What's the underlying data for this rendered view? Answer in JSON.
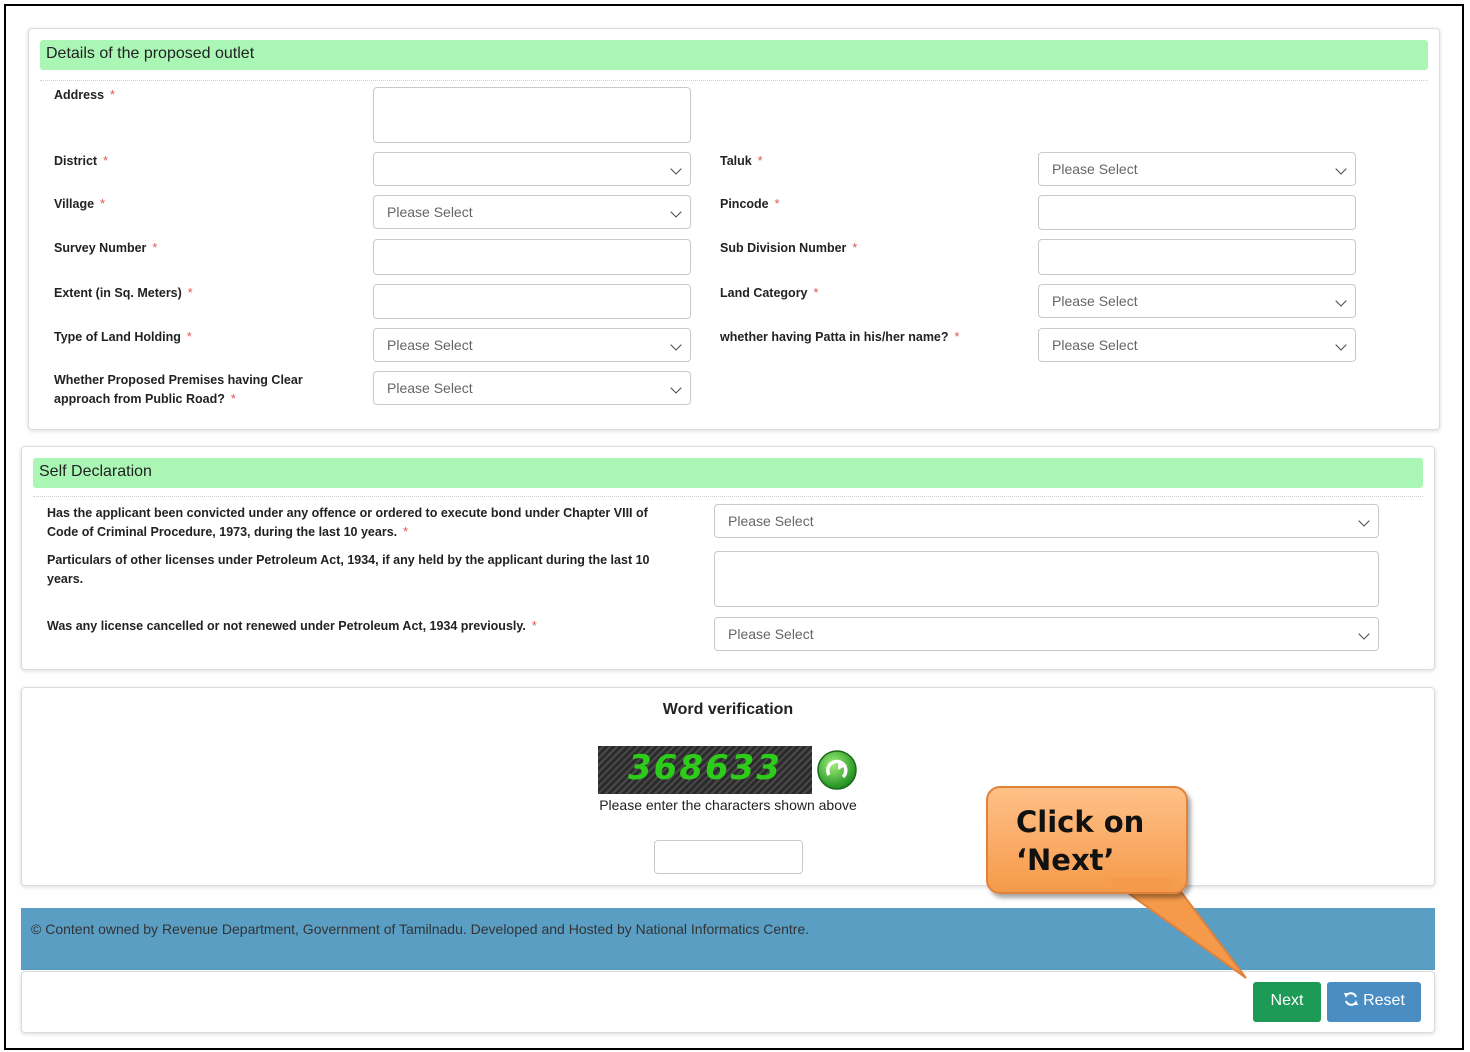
{
  "outlet": {
    "title": "Details of the proposed outlet",
    "address_label": "Address",
    "district_label": "District",
    "taluk_label": "Taluk",
    "village_label": "Village",
    "pincode_label": "Pincode",
    "survey_label": "Survey Number",
    "subdivision_label": "Sub Division Number",
    "extent_label": "Extent (in Sq. Meters)",
    "land_category_label": "Land Category",
    "land_holding_label": "Type of Land Holding",
    "patta_label": "whether having Patta in his/her name?",
    "approach_label_line1": "Whether Proposed Premises having Clear",
    "approach_label_line2": "approach from Public Road?",
    "district_value": "",
    "select_placeholder": "Please Select",
    "required_mark": "*"
  },
  "declaration": {
    "title": "Self Declaration",
    "q1_line1": "Has the applicant been convicted under any offence or ordered to execute bond under Chapter VIII of",
    "q1_line2": "Code of Criminal Procedure, 1973, during the last 10 years.",
    "q2_line1": "Particulars of other licenses under Petroleum Act, 1934, if any held by the applicant during the last 10",
    "q2_line2": "years.",
    "q3": "Was any license cancelled or not renewed under Petroleum Act, 1934 previously.",
    "select_placeholder": "Please Select"
  },
  "verification": {
    "title": "Word verification",
    "captcha_text": "368633",
    "hint": "Please enter the characters shown above",
    "input_value": ""
  },
  "footer": {
    "text": "© Content owned by Revenue Department, Government of Tamilnadu. Developed and Hosted by National Informatics Centre."
  },
  "actions": {
    "next_label": "Next",
    "reset_label": "Reset"
  },
  "callout": {
    "line1": "Click on",
    "line2": "‘Next’"
  },
  "colors": {
    "section_header": "#aaf7b5",
    "footer_bg": "#5a9ec4",
    "next_button": "#1d9a55",
    "reset_button": "#4a8dc3",
    "callout": "#f7a55c",
    "captcha_digits": "#2ecc1a"
  },
  "icons": {
    "refresh_captcha": "refresh-icon",
    "reset": "refresh-icon",
    "select_arrow": "chevron-down-icon"
  }
}
